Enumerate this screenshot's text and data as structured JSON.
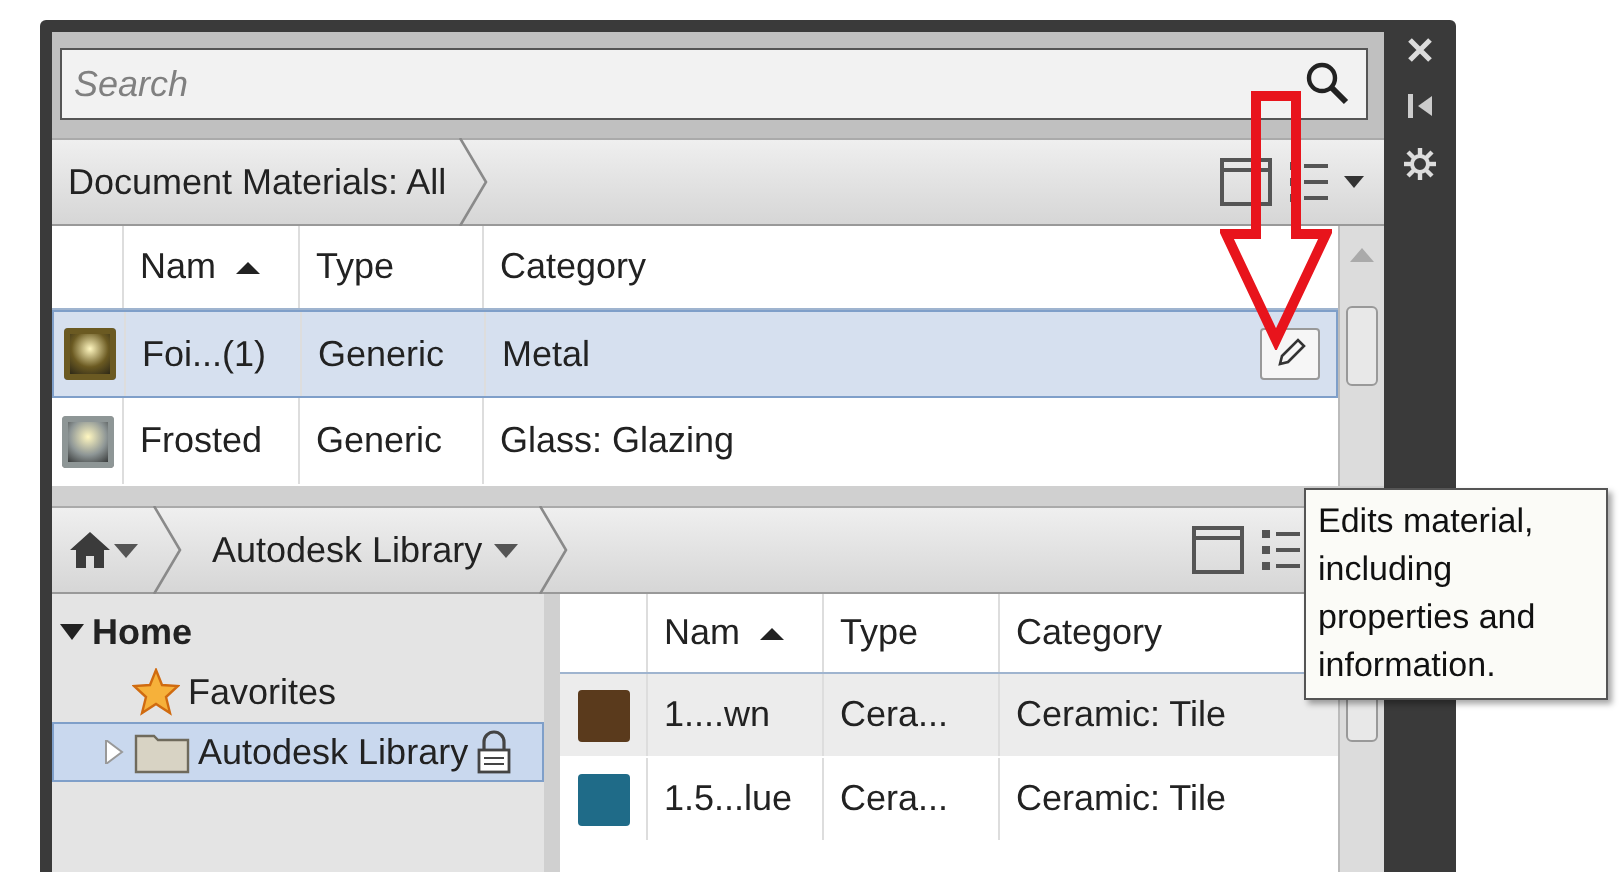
{
  "search": {
    "placeholder": "Search"
  },
  "document_bar": {
    "label": "Document Materials: All"
  },
  "document_table": {
    "columns": [
      {
        "label": "Nam",
        "sorted": true
      },
      {
        "label": "Type",
        "sorted": false
      },
      {
        "label": "Category",
        "sorted": false
      }
    ],
    "rows": [
      {
        "name": "Foi...(1)",
        "type": "Generic",
        "category": "Metal",
        "color": "#6b5a22",
        "selected": true
      },
      {
        "name": "Frosted",
        "type": "Generic",
        "category": "Glass: Glazing",
        "color": "#8e9696",
        "selected": false
      }
    ]
  },
  "library_bar": {
    "label": "Autodesk Library"
  },
  "tree": [
    {
      "label": "Home",
      "kind": "home",
      "expanded": true,
      "children": [
        {
          "label": "Favorites",
          "kind": "favorite",
          "selected": false,
          "locked": false
        },
        {
          "label": "Autodesk Library",
          "kind": "folder",
          "selected": true,
          "locked": true,
          "expanded": false
        }
      ]
    }
  ],
  "library_table": {
    "columns": [
      {
        "label": "Nam",
        "sorted": true
      },
      {
        "label": "Type",
        "sorted": false
      },
      {
        "label": "Category",
        "sorted": false
      }
    ],
    "rows": [
      {
        "name": "1....wn",
        "type": "Cera...",
        "category": "Ceramic: Tile",
        "color": "#5a3a1c",
        "selected": false
      },
      {
        "name": "1.5...lue",
        "type": "Cera...",
        "category": "Ceramic: Tile",
        "color": "#1f6b88",
        "selected": false
      }
    ]
  },
  "tooltip": {
    "text": "Edits material, including properties and information."
  }
}
